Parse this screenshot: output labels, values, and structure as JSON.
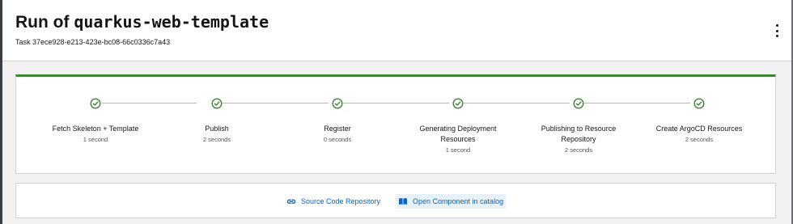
{
  "header": {
    "title_prefix": "Run of ",
    "title_name": "quarkus-web-template",
    "task_id": "Task 37ece928-e213-423e-bc08-66c0336c7a43",
    "menu_icon": "kebab-menu-icon"
  },
  "steps": [
    {
      "label": "Fetch Skeleton + Template",
      "duration": "1 second",
      "status": "completed"
    },
    {
      "label": "Publish",
      "duration": "2 seconds",
      "status": "completed"
    },
    {
      "label": "Register",
      "duration": "0 seconds",
      "status": "completed"
    },
    {
      "label": "Generating Deployment Resources",
      "duration": "1 second",
      "status": "completed"
    },
    {
      "label": "Publishing to Resource Repository",
      "duration": "2 seconds",
      "status": "completed"
    },
    {
      "label": "Create ArgoCD Resources",
      "duration": "2 seconds",
      "status": "completed"
    }
  ],
  "links": {
    "source_repo": "Source Code Repository",
    "open_component": "Open Component in catalog"
  },
  "colors": {
    "success": "#3e8635",
    "link": "#0066cc",
    "connector": "#b8bbbe"
  }
}
